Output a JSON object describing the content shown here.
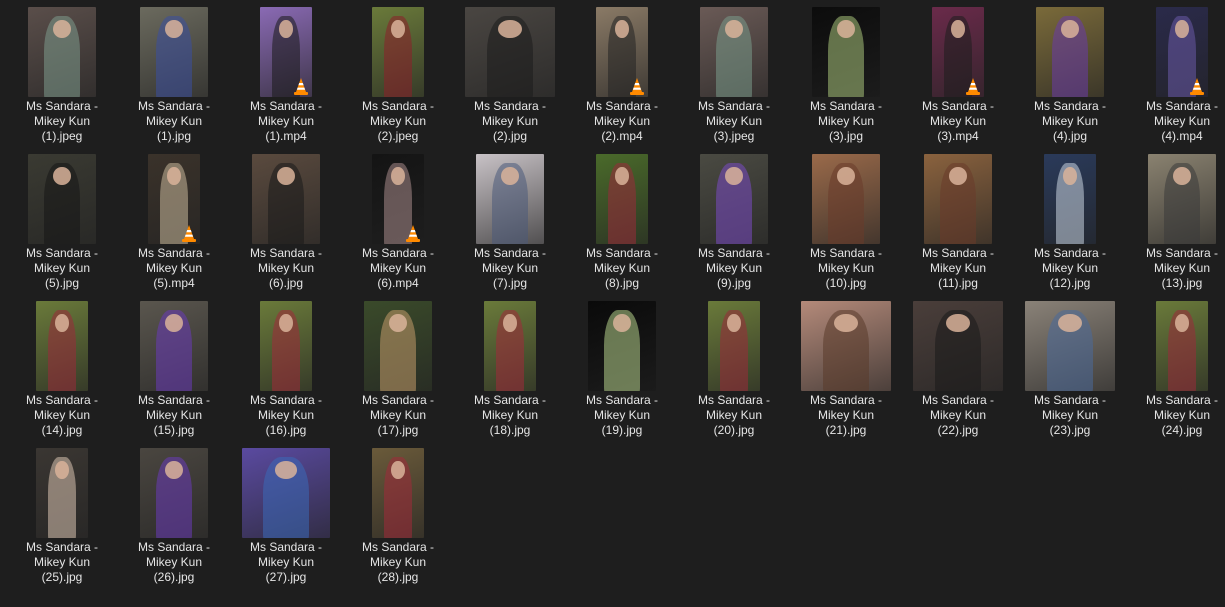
{
  "files": [
    {
      "name": "Ms Sandara -\nMikey Kun\n(1).jpeg",
      "type": "image",
      "bg": "#5a4e4a",
      "fig": "#7d9a8c",
      "shape": "portrait"
    },
    {
      "name": "Ms Sandara -\nMikey Kun\n(1).jpg",
      "type": "image",
      "bg": "#6b6a5e",
      "fig": "#3a4fa0",
      "shape": "portrait"
    },
    {
      "name": "Ms Sandara -\nMikey Kun\n(1).mp4",
      "type": "video",
      "bg": "#8a6ab4",
      "fig": "#1a1a1a",
      "shape": "narrow"
    },
    {
      "name": "Ms Sandara -\nMikey Kun\n(2).jpeg",
      "type": "image",
      "bg": "#6a7a3a",
      "fig": "#8c1f2a",
      "shape": "narrow"
    },
    {
      "name": "Ms Sandara -\nMikey Kun\n(2).jpg",
      "type": "image",
      "bg": "#4a4642",
      "fig": "#1c1c1c",
      "shape": "wide"
    },
    {
      "name": "Ms Sandara -\nMikey Kun\n(2).mp4",
      "type": "video",
      "bg": "#8a7a66",
      "fig": "#222222",
      "shape": "narrow"
    },
    {
      "name": "Ms Sandara -\nMikey Kun\n(3).jpeg",
      "type": "image",
      "bg": "#6a5a56",
      "fig": "#7a9a8a",
      "shape": "portrait"
    },
    {
      "name": "Ms Sandara -\nMikey Kun\n(3).jpg",
      "type": "image",
      "bg": "#0c0c0c",
      "fig": "#a8c27a",
      "shape": "portrait"
    },
    {
      "name": "Ms Sandara -\nMikey Kun\n(3).mp4",
      "type": "video",
      "bg": "#6a2a4a",
      "fig": "#1e1e1e",
      "shape": "narrow"
    },
    {
      "name": "Ms Sandara -\nMikey Kun\n(4).jpg",
      "type": "image",
      "bg": "#7a6a3a",
      "fig": "#6a3aa8",
      "shape": "portrait"
    },
    {
      "name": "Ms Sandara -\nMikey Kun\n(4).mp4",
      "type": "video",
      "bg": "#2a2a4a",
      "fig": "#6a5aa8",
      "shape": "narrow"
    },
    {
      "name": "Ms Sandara -\nMikey Kun\n(5).jpg",
      "type": "image",
      "bg": "#3a3a32",
      "fig": "#151515",
      "shape": "portrait"
    },
    {
      "name": "Ms Sandara -\nMikey Kun\n(5).mp4",
      "type": "video",
      "bg": "#3a322a",
      "fig": "#c8b89a",
      "shape": "narrow"
    },
    {
      "name": "Ms Sandara -\nMikey Kun\n(6).jpg",
      "type": "image",
      "bg": "#5a4a3e",
      "fig": "#1a1a1a",
      "shape": "portrait"
    },
    {
      "name": "Ms Sandara -\nMikey Kun\n(6).mp4",
      "type": "video",
      "bg": "#141414",
      "fig": "#a88a8a",
      "shape": "narrow"
    },
    {
      "name": "Ms Sandara -\nMikey Kun\n(7).jpg",
      "type": "image",
      "bg": "#c8c2c6",
      "fig": "#4a5a7a",
      "shape": "portrait"
    },
    {
      "name": "Ms Sandara -\nMikey Kun\n(8).jpg",
      "type": "image",
      "bg": "#4a6a2a",
      "fig": "#9a2a3a",
      "shape": "narrow"
    },
    {
      "name": "Ms Sandara -\nMikey Kun\n(9).jpg",
      "type": "image",
      "bg": "#4a4a42",
      "fig": "#7a4ac2",
      "shape": "portrait"
    },
    {
      "name": "Ms Sandara -\nMikey Kun\n(10).jpg",
      "type": "image",
      "bg": "#9a6a4a",
      "fig": "#6a3a2a",
      "shape": "portrait"
    },
    {
      "name": "Ms Sandara -\nMikey Kun\n(11).jpg",
      "type": "image",
      "bg": "#8a623e",
      "fig": "#6a3a2a",
      "shape": "portrait"
    },
    {
      "name": "Ms Sandara -\nMikey Kun\n(12).jpg",
      "type": "image",
      "bg": "#2a3a5a",
      "fig": "#c8d4e0",
      "shape": "narrow"
    },
    {
      "name": "Ms Sandara -\nMikey Kun\n(13).jpg",
      "type": "image",
      "bg": "#8a8270",
      "fig": "#3a3a3a",
      "shape": "portrait"
    },
    {
      "name": "Ms Sandara -\nMikey Kun\n(14).jpg",
      "type": "image",
      "bg": "#6a7a3a",
      "fig": "#9a2a3a",
      "shape": "narrow"
    },
    {
      "name": "Ms Sandara -\nMikey Kun\n(15).jpg",
      "type": "image",
      "bg": "#5a564e",
      "fig": "#6a3ab8",
      "shape": "portrait"
    },
    {
      "name": "Ms Sandara -\nMikey Kun\n(16).jpg",
      "type": "image",
      "bg": "#6a7a3a",
      "fig": "#a02a3a",
      "shape": "narrow"
    },
    {
      "name": "Ms Sandara -\nMikey Kun\n(17).jpg",
      "type": "image",
      "bg": "#3a4a2a",
      "fig": "#c29a6a",
      "shape": "portrait"
    },
    {
      "name": "Ms Sandara -\nMikey Kun\n(18).jpg",
      "type": "image",
      "bg": "#6a7a3a",
      "fig": "#a02a3a",
      "shape": "narrow"
    },
    {
      "name": "Ms Sandara -\nMikey Kun\n(19).jpg",
      "type": "image",
      "bg": "#0a0a0a",
      "fig": "#b4d08a",
      "shape": "portrait"
    },
    {
      "name": "Ms Sandara -\nMikey Kun\n(20).jpg",
      "type": "image",
      "bg": "#6a7a3a",
      "fig": "#9a2a3a",
      "shape": "narrow"
    },
    {
      "name": "Ms Sandara -\nMikey Kun\n(21).jpg",
      "type": "image",
      "bg": "#b48a7a",
      "fig": "#5a3a2a",
      "shape": "wide"
    },
    {
      "name": "Ms Sandara -\nMikey Kun\n(22).jpg",
      "type": "image",
      "bg": "#4a3e3a",
      "fig": "#1a1a1a",
      "shape": "wide"
    },
    {
      "name": "Ms Sandara -\nMikey Kun\n(23).jpg",
      "type": "image",
      "bg": "#8a8278",
      "fig": "#4a6a9a",
      "shape": "wide"
    },
    {
      "name": "Ms Sandara -\nMikey Kun\n(24).jpg",
      "type": "image",
      "bg": "#6a7a3a",
      "fig": "#9a2a3a",
      "shape": "narrow"
    },
    {
      "name": "Ms Sandara -\nMikey Kun\n(25).jpg",
      "type": "image",
      "bg": "#3a3632",
      "fig": "#d8c2b0",
      "shape": "narrow"
    },
    {
      "name": "Ms Sandara -\nMikey Kun\n(26).jpg",
      "type": "image",
      "bg": "#4a4640",
      "fig": "#6a3ab8",
      "shape": "portrait"
    },
    {
      "name": "Ms Sandara -\nMikey Kun\n(27).jpg",
      "type": "image",
      "bg": "#5a4aa0",
      "fig": "#3a6ab8",
      "shape": "square"
    },
    {
      "name": "Ms Sandara -\nMikey Kun\n(28).jpg",
      "type": "image",
      "bg": "#6a5a3a",
      "fig": "#a02a3a",
      "shape": "narrow"
    }
  ]
}
